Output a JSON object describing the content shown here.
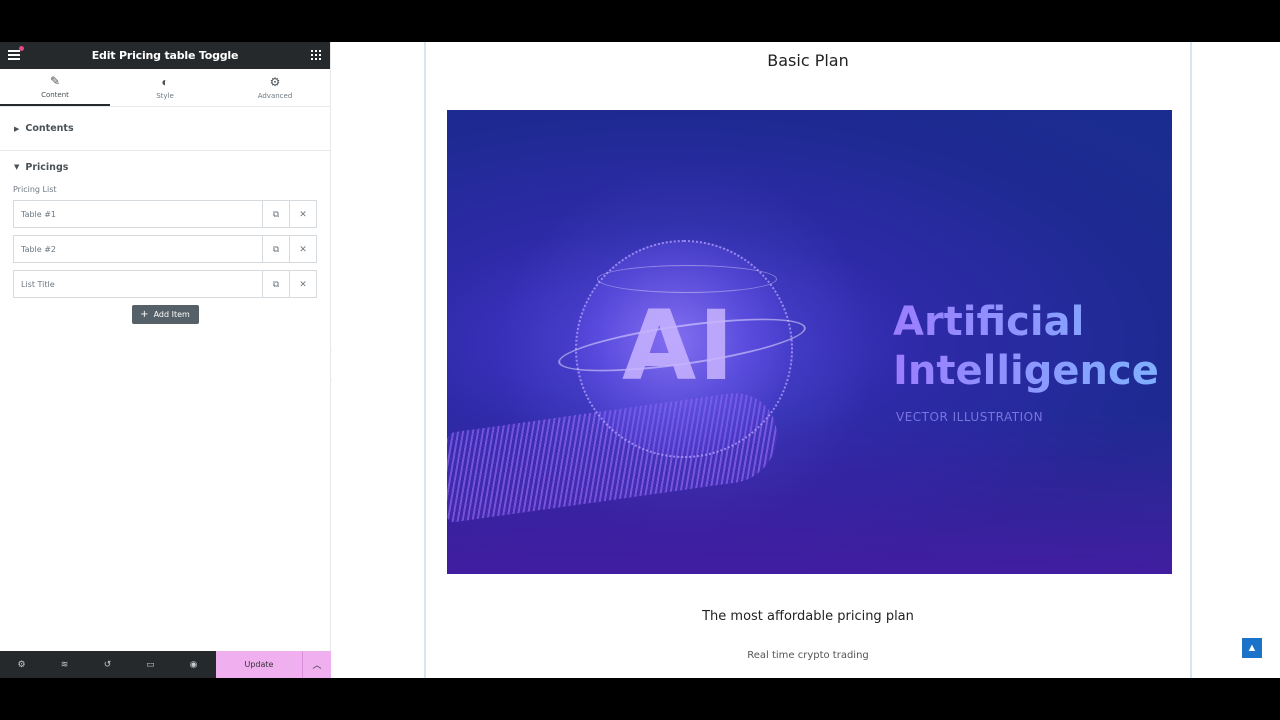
{
  "panel": {
    "title": "Edit Pricing table Toggle",
    "tabs": [
      {
        "label": "Content",
        "icon": "pencil-icon",
        "glyph": "✎"
      },
      {
        "label": "Style",
        "icon": "contrast-icon",
        "glyph": "◐"
      },
      {
        "label": "Advanced",
        "icon": "gear-icon",
        "glyph": "⚙"
      }
    ],
    "sections": {
      "contents": "Contents",
      "pricings": "Pricings"
    },
    "pricing_list_label": "Pricing List",
    "items": [
      {
        "title": "Table #1"
      },
      {
        "title": "Table #2"
      },
      {
        "title": "List Title"
      }
    ],
    "add_item_label": "Add Item",
    "footer": {
      "icons": [
        "settings-icon",
        "layers-icon",
        "history-icon",
        "responsive-icon",
        "preview-icon"
      ],
      "update_label": "Update"
    }
  },
  "preview": {
    "plan_name": "Basic Plan",
    "hero": {
      "big_text": "AI",
      "title_line1": "Artificial",
      "title_line2": "Intelligence",
      "subtitle": "VECTOR ILLUSTRATION"
    },
    "tagline": "The most affordable pricing plan",
    "features": [
      "Real time crypto trading"
    ]
  },
  "colors": {
    "panel_header": "#26292c",
    "update_button": "#f0b0f0",
    "scroll_top": "#1a73c9",
    "hero_bg": "#1e2a92"
  }
}
